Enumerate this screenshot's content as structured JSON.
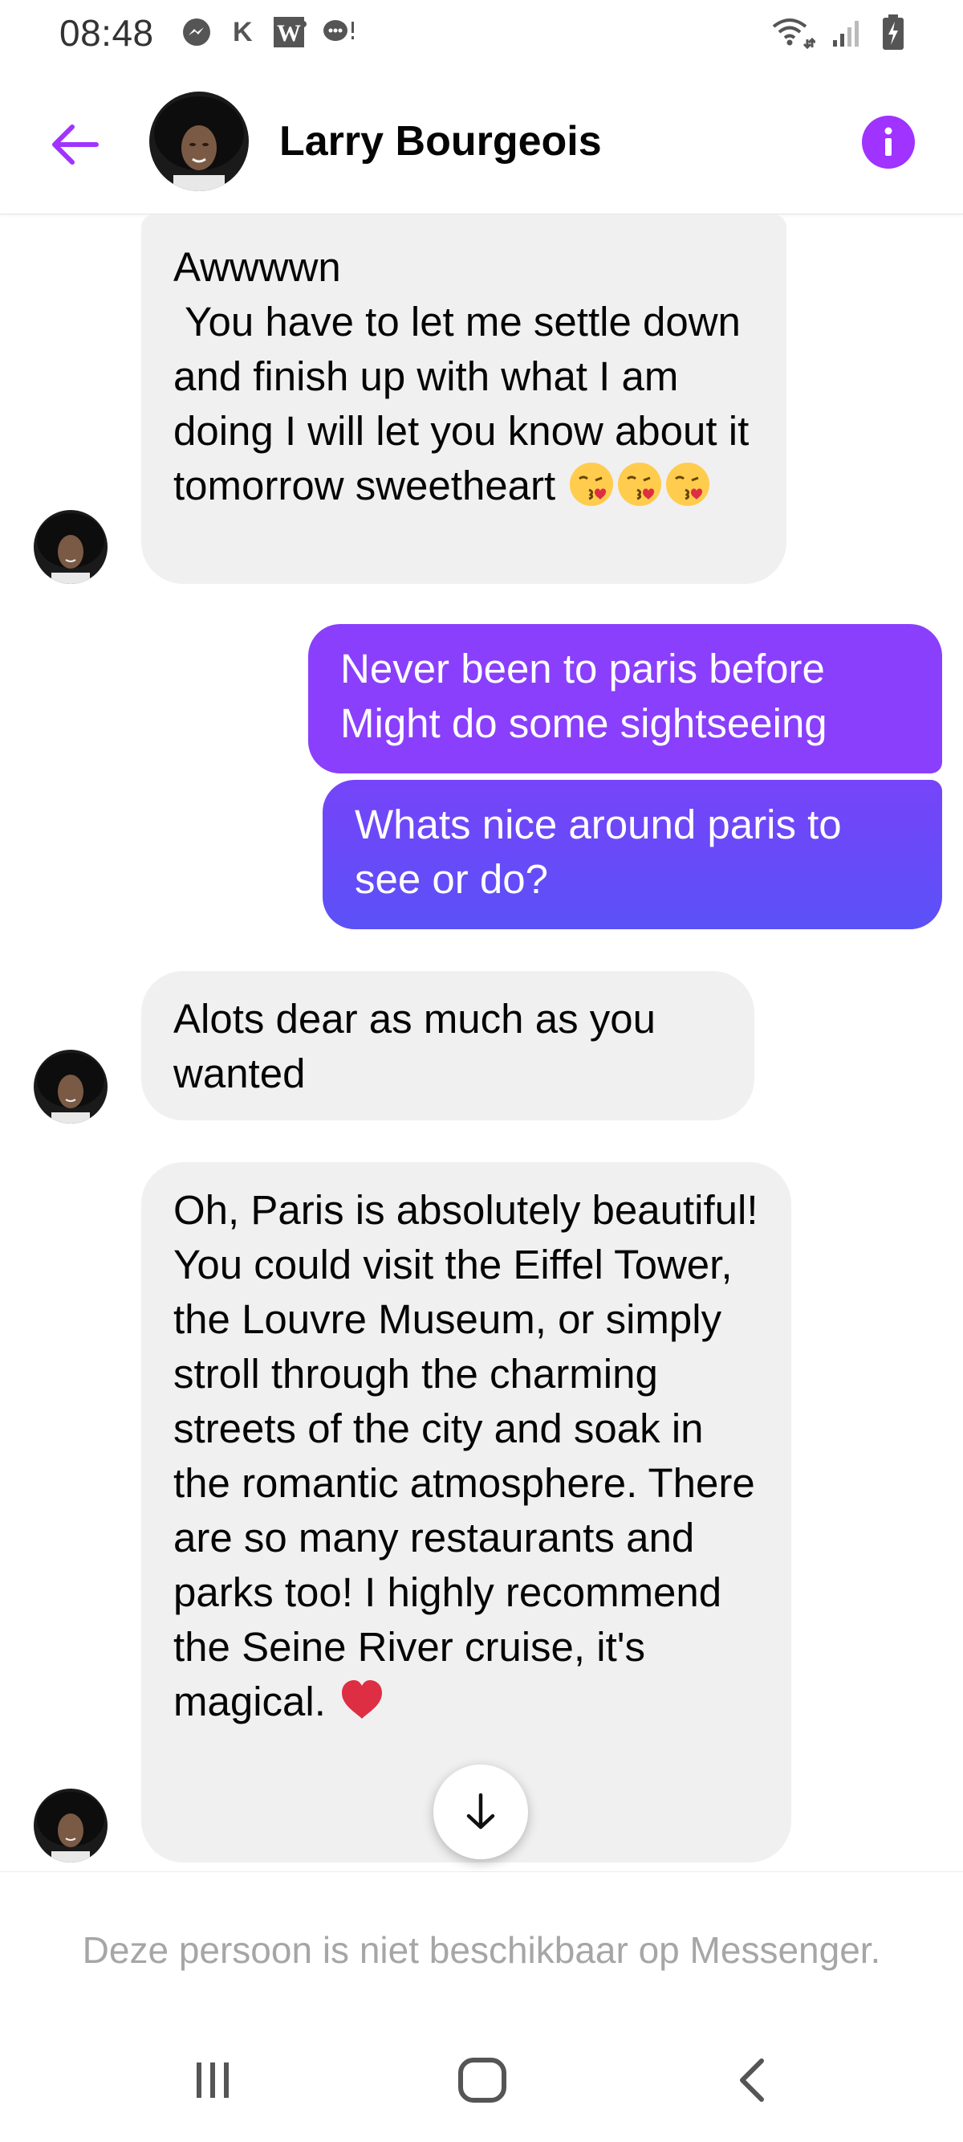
{
  "status_bar": {
    "time": "08:48",
    "notification_icons": [
      "messenger-icon",
      "k-app-icon",
      "w-app-icon",
      "chat-bubble-icon"
    ],
    "k_label": "K",
    "w_label": "W",
    "right_icons": [
      "wifi-icon",
      "signal-icon",
      "battery-charging-icon"
    ]
  },
  "header": {
    "contact_name": "Larry Bourgeois",
    "back_icon": "back-arrow-icon",
    "info_icon": "info-icon",
    "accent_color": "#a033ff"
  },
  "messages": [
    {
      "direction": "incoming",
      "text": "Awwwwn\n You have to let me settle down and finish up with what I am doing I will let you know about it tomorrow sweetheart",
      "emojis": [
        "kissing-face-with-heart",
        "kissing-face-with-heart",
        "kissing-face-with-heart"
      ]
    },
    {
      "direction": "outgoing",
      "text": "Never been to paris before\nMight do some sightseeing"
    },
    {
      "direction": "outgoing",
      "text": "Whats nice around paris to see or do?"
    },
    {
      "direction": "incoming",
      "text": "Alots dear as much as you wanted"
    },
    {
      "direction": "incoming",
      "text": "Oh, Paris is absolutely beautiful! You could visit the Eiffel Tower, the Louvre Museum, or simply stroll through the charming streets of the city and soak in the romantic atmosphere. There are so many restaurants and parks too! I highly recommend the Seine River cruise, it's magical.",
      "emojis": [
        "red-heart"
      ]
    }
  ],
  "scroll_down_icon": "arrow-down-icon",
  "footer": {
    "unavailable_text": "Deze persoon is niet beschikbaar op Messenger."
  },
  "nav_bar": {
    "recents_icon": "recent-apps-icon",
    "home_icon": "home-icon",
    "back_icon": "nav-back-icon"
  },
  "colors": {
    "outgoing_gradient_top": "#8a3ffc",
    "outgoing_gradient_bottom": "#5b51f7",
    "incoming_bubble": "#f0f0f0",
    "unavailable_text": "#a6a6a6"
  }
}
